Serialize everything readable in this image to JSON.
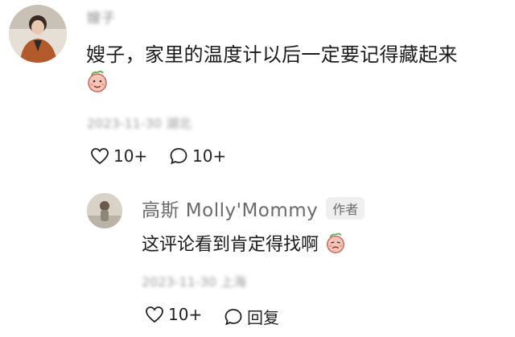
{
  "comment": {
    "user_name": "嫂子",
    "text": "嫂子，家里的温度计以后一定要记得藏起来",
    "meta": "2023-11-30 湖北",
    "like_count": "10+",
    "reply_count": "10+"
  },
  "reply": {
    "user_name": "高斯 Molly'Mommy",
    "badge": "作者",
    "text": "这评论看到肯定得找啊",
    "meta": "2023-11-30 上海",
    "like_count": "10+",
    "reply_label": "回复"
  }
}
